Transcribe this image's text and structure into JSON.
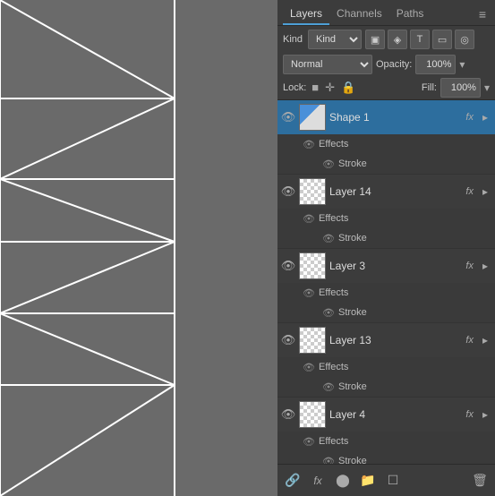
{
  "canvas": {
    "background_color": "#6a6a6a"
  },
  "panel": {
    "tabs": [
      {
        "label": "Layers",
        "active": true
      },
      {
        "label": "Channels",
        "active": false
      },
      {
        "label": "Paths",
        "active": false
      }
    ],
    "kind_label": "Kind",
    "kind_value": "Kind",
    "blend_mode": "Normal",
    "opacity_label": "Opacity:",
    "opacity_value": "100%",
    "lock_label": "Lock:",
    "fill_label": "Fill:",
    "fill_value": "100%",
    "layers": [
      {
        "name": "Shape 1",
        "thumb_type": "shape",
        "fx": "fx",
        "selected": true,
        "effects": true,
        "stroke": true
      },
      {
        "name": "Layer 14",
        "thumb_type": "checker",
        "fx": "fx",
        "selected": false,
        "effects": true,
        "stroke": true
      },
      {
        "name": "Layer 3",
        "thumb_type": "checker",
        "fx": "fx",
        "selected": false,
        "effects": true,
        "stroke": true
      },
      {
        "name": "Layer 13",
        "thumb_type": "checker",
        "fx": "fx",
        "selected": false,
        "effects": true,
        "stroke": true
      },
      {
        "name": "Layer 4",
        "thumb_type": "checker",
        "fx": "fx",
        "selected": false,
        "effects": true,
        "stroke": true
      }
    ],
    "footer_icons": [
      "link-icon",
      "fx-icon",
      "adjustment-icon",
      "folder-icon",
      "new-layer-icon",
      "trash-icon"
    ]
  }
}
